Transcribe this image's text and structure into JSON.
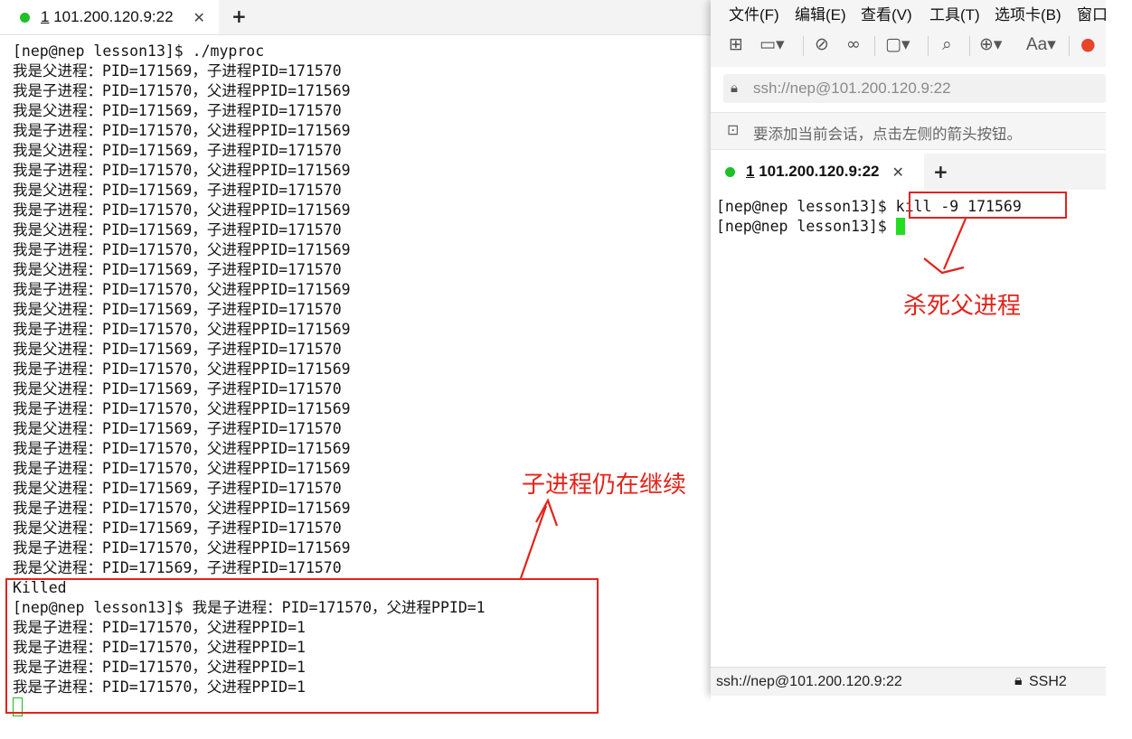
{
  "left_window": {
    "tab": {
      "number": "1",
      "label": " 101.200.120.9:22",
      "close": "✕",
      "new_tab": "+"
    },
    "lines": [
      "[nep@nep lesson13]$ ./myproc",
      "我是父进程：PID=171569，子进程PID=171570",
      "我是子进程：PID=171570，父进程PPID=171569",
      "我是父进程：PID=171569，子进程PID=171570",
      "我是子进程：PID=171570，父进程PPID=171569",
      "我是父进程：PID=171569，子进程PID=171570",
      "我是子进程：PID=171570，父进程PPID=171569",
      "我是父进程：PID=171569，子进程PID=171570",
      "我是子进程：PID=171570，父进程PPID=171569",
      "我是父进程：PID=171569，子进程PID=171570",
      "我是子进程：PID=171570，父进程PPID=171569",
      "我是父进程：PID=171569，子进程PID=171570",
      "我是子进程：PID=171570，父进程PPID=171569",
      "我是父进程：PID=171569，子进程PID=171570",
      "我是子进程：PID=171570，父进程PPID=171569",
      "我是父进程：PID=171569，子进程PID=171570",
      "我是子进程：PID=171570，父进程PPID=171569",
      "我是父进程：PID=171569，子进程PID=171570",
      "我是子进程：PID=171570，父进程PPID=171569",
      "我是父进程：PID=171569，子进程PID=171570",
      "我是子进程：PID=171570，父进程PPID=171569",
      "我是子进程：PID=171570，父进程PPID=171569",
      "我是父进程：PID=171569，子进程PID=171570",
      "我是子进程：PID=171570，父进程PPID=171569",
      "我是父进程：PID=171569，子进程PID=171570",
      "我是子进程：PID=171570，父进程PPID=171569",
      "我是父进程：PID=171569，子进程PID=171570",
      "Killed",
      "[nep@nep lesson13]$ 我是子进程：PID=171570，父进程PPID=1",
      "我是子进程：PID=171570，父进程PPID=1",
      "我是子进程：PID=171570，父进程PPID=1",
      "我是子进程：PID=171570，父进程PPID=1",
      "我是子进程：PID=171570，父进程PPID=1"
    ]
  },
  "right_window": {
    "menu": [
      "文件(F)",
      "编辑(E)",
      "查看(V)",
      "工具(T)",
      "选项卡(B)",
      "窗口"
    ],
    "toolbar_icons": [
      "new-session-icon",
      "open-folder-icon",
      "disconnect-icon",
      "link-icon",
      "screen-icon",
      "search-icon",
      "globe-icon",
      "font-icon",
      "logo-icon"
    ],
    "toolbar_font_label": "Aa",
    "address": "ssh://nep@101.200.120.9:22",
    "hint": "要添加当前会话，点击左侧的箭头按钮。",
    "tab": {
      "number": "1",
      "label": " 101.200.120.9:22",
      "close": "✕",
      "new_tab": "+"
    },
    "lines": [
      "[nep@nep lesson13]$ kill -9 171569",
      "[nep@nep lesson13]$ "
    ],
    "status": {
      "address": "ssh://nep@101.200.120.9:22",
      "protocol": "SSH2"
    }
  },
  "annotations": {
    "child_continues": "子进程仍在继续",
    "kill_parent": "杀死父进程"
  },
  "colors": {
    "annotation_red": "#e2231a",
    "connected_green": "#1fbf2a",
    "cursor_green": "#22dd22"
  }
}
